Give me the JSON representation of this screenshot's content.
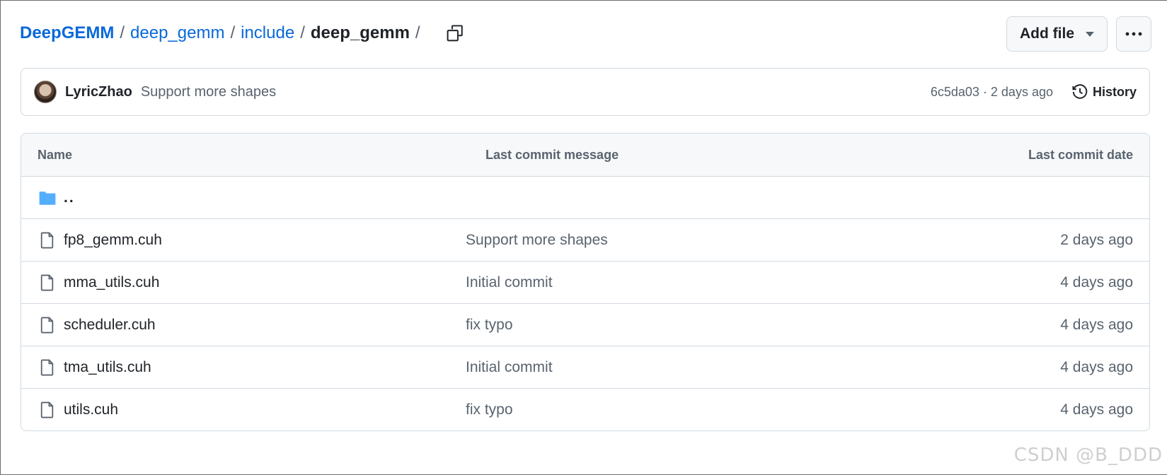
{
  "breadcrumb": {
    "repo": "DeepGEMM",
    "segments": [
      "deep_gemm",
      "include"
    ],
    "current": "deep_gemm",
    "separator": "/"
  },
  "actions": {
    "add_file_label": "Add file",
    "copy_icon": "copy-icon",
    "more_icon": "kebab-horizontal-icon"
  },
  "commit": {
    "author": "LyricZhao",
    "message": "Support more shapes",
    "hash": "6c5da03",
    "separator": " · ",
    "time": "2 days ago",
    "history_label": "History"
  },
  "table": {
    "headers": {
      "name": "Name",
      "message": "Last commit message",
      "date": "Last commit date"
    },
    "parent": "..",
    "rows": [
      {
        "name": "fp8_gemm.cuh",
        "message": "Support more shapes",
        "date": "2 days ago"
      },
      {
        "name": "mma_utils.cuh",
        "message": "Initial commit",
        "date": "4 days ago"
      },
      {
        "name": "scheduler.cuh",
        "message": "fix typo",
        "date": "4 days ago"
      },
      {
        "name": "tma_utils.cuh",
        "message": "Initial commit",
        "date": "4 days ago"
      },
      {
        "name": "utils.cuh",
        "message": "fix typo",
        "date": "4 days ago"
      }
    ]
  },
  "watermark": "CSDN @B_DDD",
  "colors": {
    "link": "#0969da",
    "folder": "#54aeff",
    "muted": "#59636e",
    "border": "#d1d9e0"
  }
}
